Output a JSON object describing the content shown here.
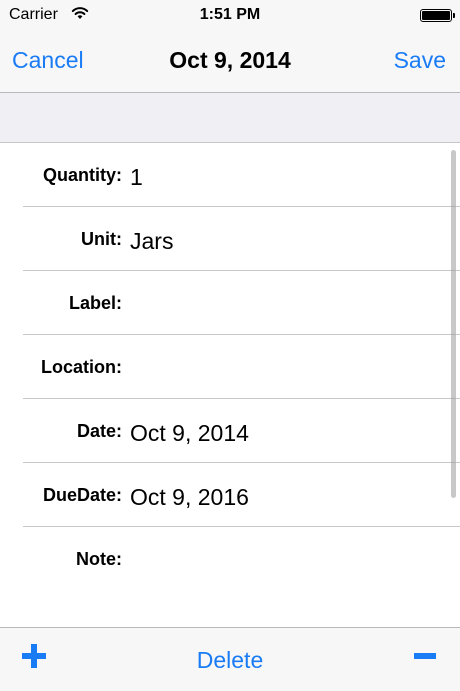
{
  "status_bar": {
    "carrier": "Carrier",
    "time": "1:51 PM"
  },
  "nav_bar": {
    "cancel_label": "Cancel",
    "title": "Oct 9, 2014",
    "save_label": "Save"
  },
  "form": {
    "rows": [
      {
        "label": "Quantity:",
        "value": "1"
      },
      {
        "label": "Unit:",
        "value": "Jars"
      },
      {
        "label": "Label:",
        "value": ""
      },
      {
        "label": "Location:",
        "value": ""
      },
      {
        "label": "Date:",
        "value": "Oct 9, 2014"
      },
      {
        "label": "DueDate:",
        "value": "Oct 9, 2016"
      },
      {
        "label": "Note:",
        "value": ""
      }
    ]
  },
  "toolbar": {
    "add_icon": "plus-icon",
    "delete_label": "Delete",
    "minus_icon": "minus-icon"
  },
  "colors": {
    "accent": "#1a7cf5",
    "bar_background": "#f7f7f7",
    "section_background": "#efeff4",
    "separator": "#c8c7cc"
  }
}
